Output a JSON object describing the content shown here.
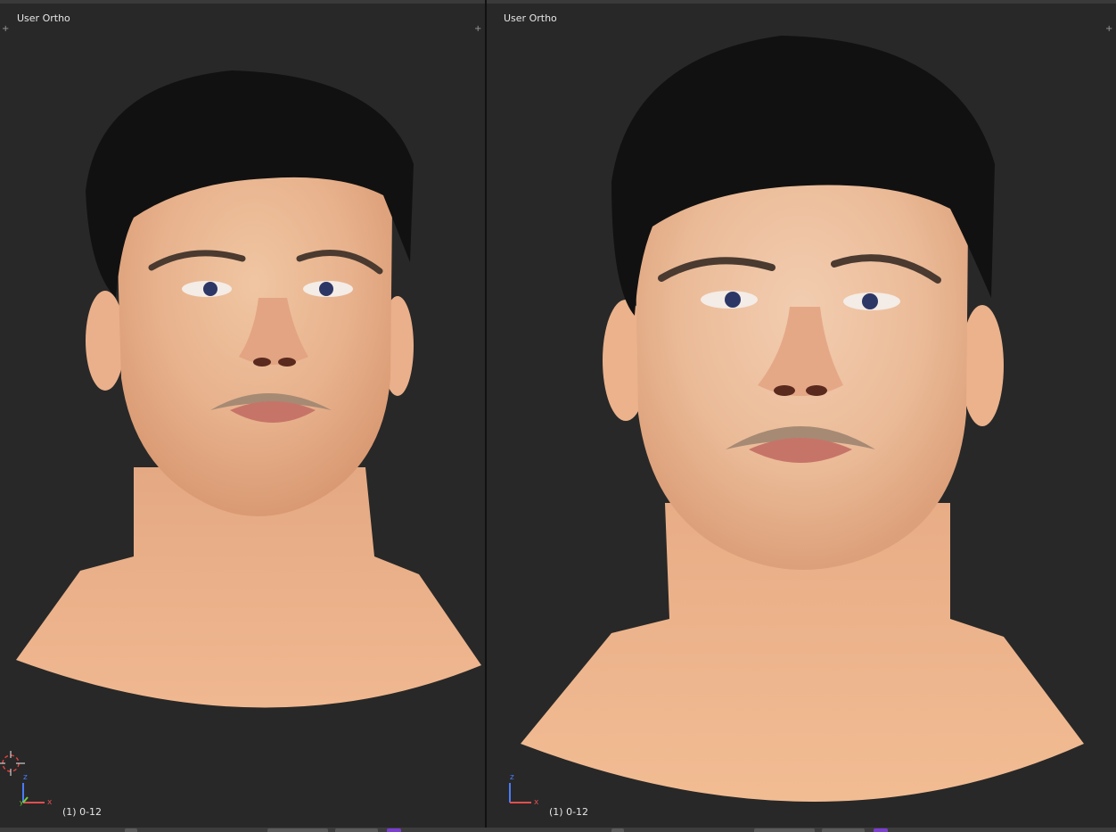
{
  "viewports": [
    {
      "id": "left",
      "title": "User Ortho",
      "frame_label": "(1) 0-12",
      "axis_labels": {
        "up": "z",
        "right": "x",
        "forward": "y"
      },
      "show_cursor": true
    },
    {
      "id": "right",
      "title": "User Ortho",
      "frame_label": "(1) 0-12",
      "axis_labels": {
        "up": "z",
        "right": "x"
      },
      "show_cursor": false
    }
  ],
  "colors": {
    "viewport_bg": "#282828",
    "axis_x": "#e05050",
    "axis_y": "#6fcf3f",
    "axis_z": "#4a7bff",
    "skin": "#e8b08a",
    "hair": "#111111",
    "accent_purple": "#7a3fd0"
  },
  "icons": [
    "plus-icon",
    "corner-grip-icon",
    "3d-cursor-icon",
    "axis-gizmo-icon"
  ]
}
